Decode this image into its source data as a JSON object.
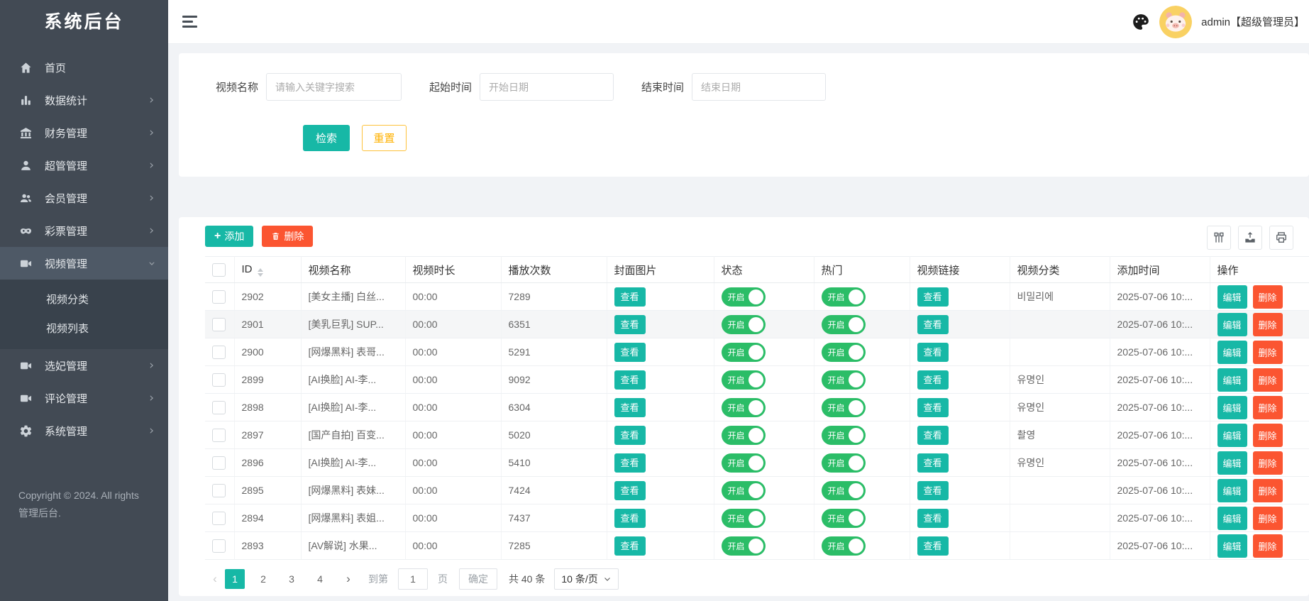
{
  "app": {
    "title": "系统后台",
    "copyright": "Copyright © 2024. All rights 管理后台."
  },
  "header": {
    "user": "admin【超级管理员】",
    "icons": [
      "menu-icon",
      "palette-icon",
      "avatar"
    ]
  },
  "sidebar": {
    "items": [
      {
        "icon": "home-icon",
        "label": "首页",
        "arrow": "",
        "active": false
      },
      {
        "icon": "chart-icon",
        "label": "数据统计",
        "arrow": "right",
        "active": false
      },
      {
        "icon": "bank-icon",
        "label": "财务管理",
        "arrow": "right",
        "active": false
      },
      {
        "icon": "user-icon",
        "label": "超管管理",
        "arrow": "right",
        "active": false
      },
      {
        "icon": "users-icon",
        "label": "会员管理",
        "arrow": "right",
        "active": false
      },
      {
        "icon": "mask-icon",
        "label": "彩票管理",
        "arrow": "right",
        "active": false
      },
      {
        "icon": "video-icon",
        "label": "视频管理",
        "arrow": "down",
        "active": true,
        "children": [
          "视频分类",
          "视频列表"
        ]
      },
      {
        "icon": "video-icon",
        "label": "选妃管理",
        "arrow": "right",
        "active": false
      },
      {
        "icon": "video-icon",
        "label": "评论管理",
        "arrow": "right",
        "active": false
      },
      {
        "icon": "gear-icon",
        "label": "系统管理",
        "arrow": "right",
        "active": false
      }
    ]
  },
  "filters": {
    "name_label": "视频名称",
    "name_placeholder": "请输入关键字搜索",
    "start_label": "起始时间",
    "start_placeholder": "开始日期",
    "end_label": "结束时间",
    "end_placeholder": "结束日期",
    "search_button": "检索",
    "reset_button": "重置"
  },
  "table": {
    "add_button": "添加",
    "delete_button": "删除",
    "tool_icons": [
      "columns-icon",
      "export-icon",
      "print-icon"
    ],
    "columns": [
      "ID",
      "视频名称",
      "视频时长",
      "播放次数",
      "封面图片",
      "状态",
      "热门",
      "视频链接",
      "视频分类",
      "添加时间",
      "操作"
    ],
    "view_label": "查看",
    "on_label": "开启",
    "edit_label": "编辑",
    "del_label": "删除",
    "rows": [
      {
        "id": "2902",
        "name": "[美女主播] 白丝...",
        "duration": "00:00",
        "plays": "7289",
        "category": "비밀리에",
        "time": "2025-07-06 10:...",
        "hovered": false
      },
      {
        "id": "2901",
        "name": "[美乳巨乳] SUP...",
        "duration": "00:00",
        "plays": "6351",
        "category": "",
        "time": "2025-07-06 10:...",
        "hovered": true
      },
      {
        "id": "2900",
        "name": "[网爆黑料] 表哥...",
        "duration": "00:00",
        "plays": "5291",
        "category": "",
        "time": "2025-07-06 10:...",
        "hovered": false
      },
      {
        "id": "2899",
        "name": "[AI换脸] AI-李...",
        "duration": "00:00",
        "plays": "9092",
        "category": "유명인",
        "time": "2025-07-06 10:...",
        "hovered": false
      },
      {
        "id": "2898",
        "name": "[AI换脸] AI-李...",
        "duration": "00:00",
        "plays": "6304",
        "category": "유명인",
        "time": "2025-07-06 10:...",
        "hovered": false
      },
      {
        "id": "2897",
        "name": "[国产自拍] 百变...",
        "duration": "00:00",
        "plays": "5020",
        "category": "촬영",
        "time": "2025-07-06 10:...",
        "hovered": false
      },
      {
        "id": "2896",
        "name": "[AI换脸] AI-李...",
        "duration": "00:00",
        "plays": "5410",
        "category": "유명인",
        "time": "2025-07-06 10:...",
        "hovered": false
      },
      {
        "id": "2895",
        "name": "[网爆黑料] 表妹...",
        "duration": "00:00",
        "plays": "7424",
        "category": "",
        "time": "2025-07-06 10:...",
        "hovered": false
      },
      {
        "id": "2894",
        "name": "[网爆黑料] 表姐...",
        "duration": "00:00",
        "plays": "7437",
        "category": "",
        "time": "2025-07-06 10:...",
        "hovered": false
      },
      {
        "id": "2893",
        "name": "[AV解说] 水果...",
        "duration": "00:00",
        "plays": "7285",
        "category": "",
        "time": "2025-07-06 10:...",
        "hovered": false
      }
    ]
  },
  "pagination": {
    "prev": "‹",
    "next": "›",
    "pages": [
      "1",
      "2",
      "3",
      "4"
    ],
    "active_page": "1",
    "goto_label": "到第",
    "goto_value": "1",
    "page_unit": "页",
    "confirm_label": "确定",
    "total_label": "共 40 条",
    "per_page_label": "10 条/页"
  },
  "colors": {
    "teal": "#17b8a6",
    "green": "#2bbd67",
    "orange_red": "#fb5531",
    "amber": "#ffb100",
    "sidebar_bg": "#424a54",
    "content_bg": "#f1f3f6"
  }
}
